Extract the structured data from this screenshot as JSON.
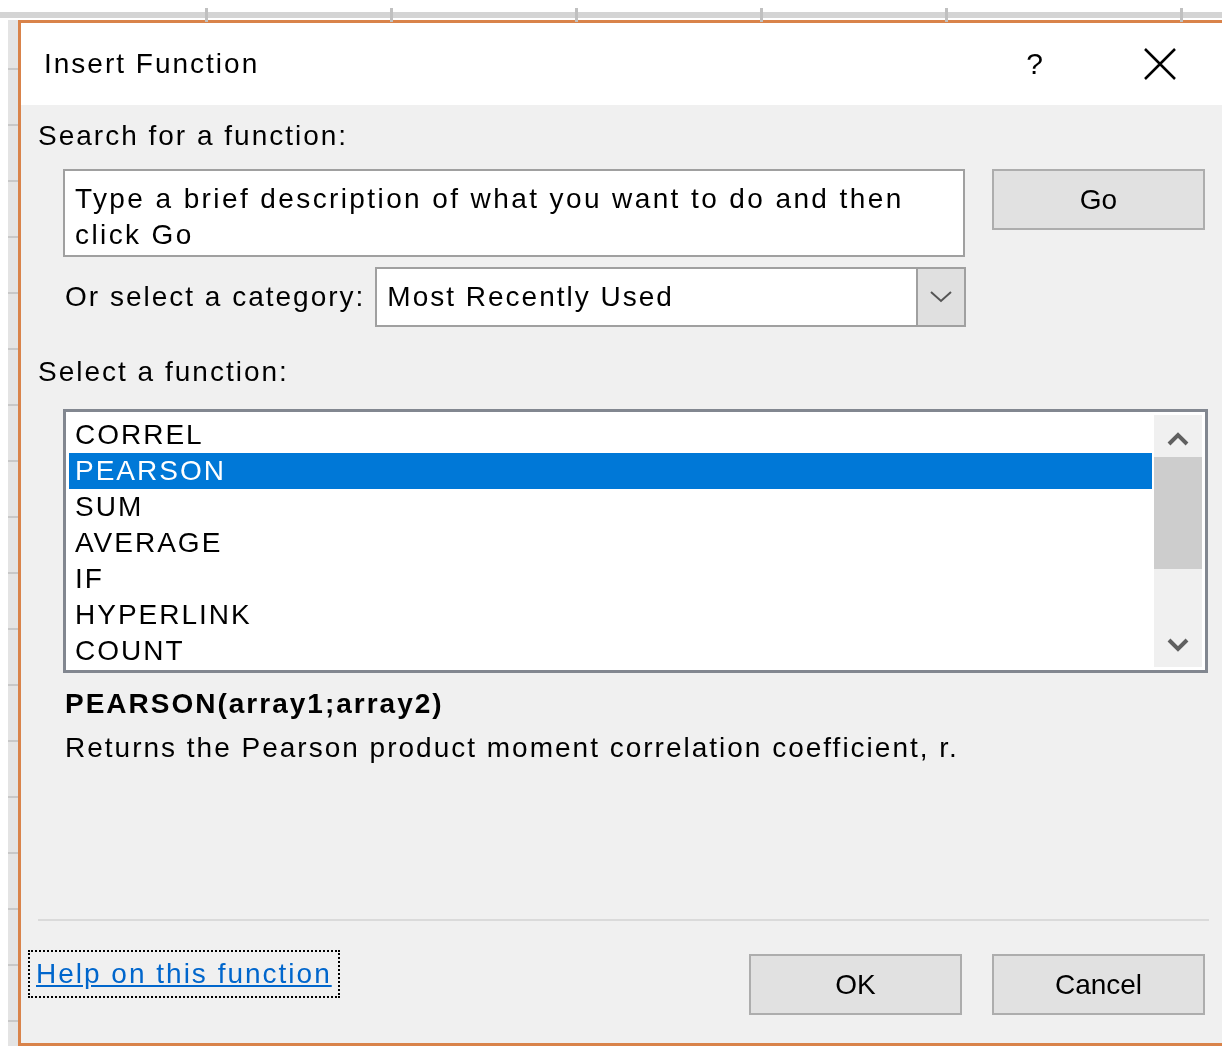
{
  "window": {
    "title": "Insert Function",
    "help_button": "?"
  },
  "search": {
    "label": "Search for a function:",
    "value": "Type a brief description of what you want to do and then click Go",
    "button": "Go"
  },
  "category": {
    "label": "Or select a category:",
    "value": "Most Recently Used"
  },
  "functions": {
    "label": "Select a function:",
    "items": [
      {
        "name": "CORREL",
        "selected": false
      },
      {
        "name": "PEARSON",
        "selected": true
      },
      {
        "name": "SUM",
        "selected": false
      },
      {
        "name": "AVERAGE",
        "selected": false
      },
      {
        "name": "IF",
        "selected": false
      },
      {
        "name": "HYPERLINK",
        "selected": false
      },
      {
        "name": "COUNT",
        "selected": false
      }
    ]
  },
  "details": {
    "signature": "PEARSON(array1;array2)",
    "description": "Returns the Pearson product moment correlation coefficient, r."
  },
  "help_link": "Help on this function",
  "buttons": [
    "OK",
    "Cancel"
  ]
}
